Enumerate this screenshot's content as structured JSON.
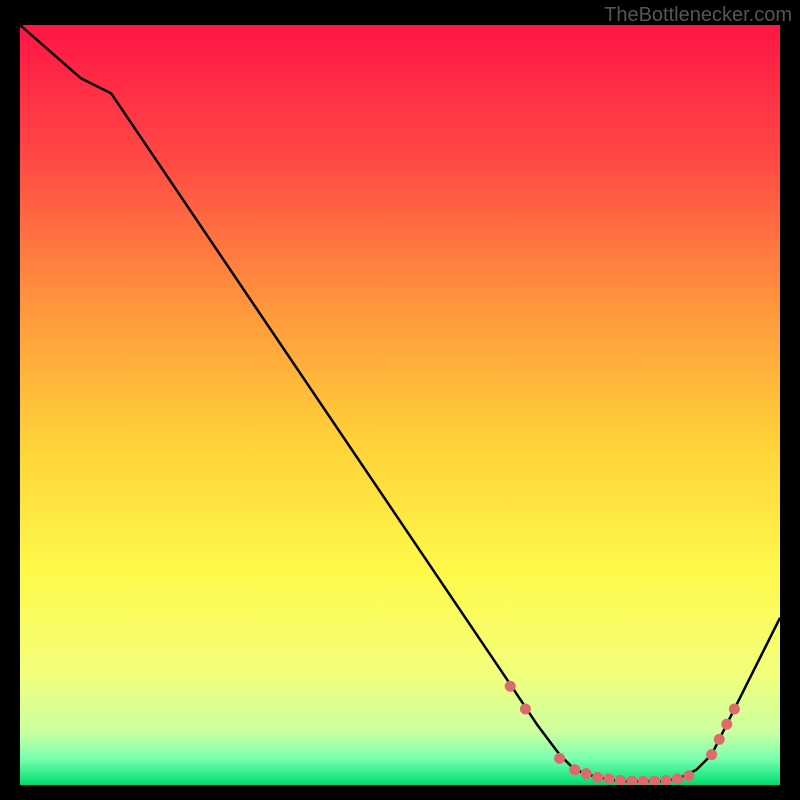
{
  "watermark": "TheBottlenecker.com",
  "chart_data": {
    "type": "line",
    "title": "",
    "xlabel": "",
    "ylabel": "",
    "xlim": [
      0,
      100
    ],
    "ylim": [
      0,
      100
    ],
    "background_gradient": {
      "top": "#ff1744",
      "upper_mid": "#ff7043",
      "mid": "#ffd740",
      "lower_mid": "#ffff8d",
      "near_bottom": "#eeff99",
      "bottom": "#00e676"
    },
    "series": [
      {
        "name": "bottleneck-curve",
        "color": "#000000",
        "x": [
          0,
          8,
          12,
          64,
          68,
          71,
          73,
          76,
          79,
          82,
          85,
          87,
          89,
          91,
          92,
          94,
          96,
          100
        ],
        "y": [
          100,
          93,
          91,
          14,
          8,
          4,
          2,
          1,
          0.5,
          0.5,
          0.5,
          1,
          2,
          4,
          6,
          10,
          14,
          22
        ]
      }
    ],
    "markers": {
      "name": "highlighted-points",
      "color": "#dd6b6b",
      "points": [
        {
          "x": 64.5,
          "y": 13
        },
        {
          "x": 66.5,
          "y": 10
        },
        {
          "x": 71,
          "y": 3.5
        },
        {
          "x": 73,
          "y": 2
        },
        {
          "x": 74.5,
          "y": 1.5
        },
        {
          "x": 76,
          "y": 1
        },
        {
          "x": 77.5,
          "y": 0.8
        },
        {
          "x": 79,
          "y": 0.6
        },
        {
          "x": 80.5,
          "y": 0.5
        },
        {
          "x": 82,
          "y": 0.5
        },
        {
          "x": 83.5,
          "y": 0.5
        },
        {
          "x": 85,
          "y": 0.6
        },
        {
          "x": 86.5,
          "y": 0.8
        },
        {
          "x": 88,
          "y": 1.2
        },
        {
          "x": 91,
          "y": 4
        },
        {
          "x": 92,
          "y": 6
        },
        {
          "x": 93,
          "y": 8
        },
        {
          "x": 94,
          "y": 10
        }
      ]
    }
  }
}
